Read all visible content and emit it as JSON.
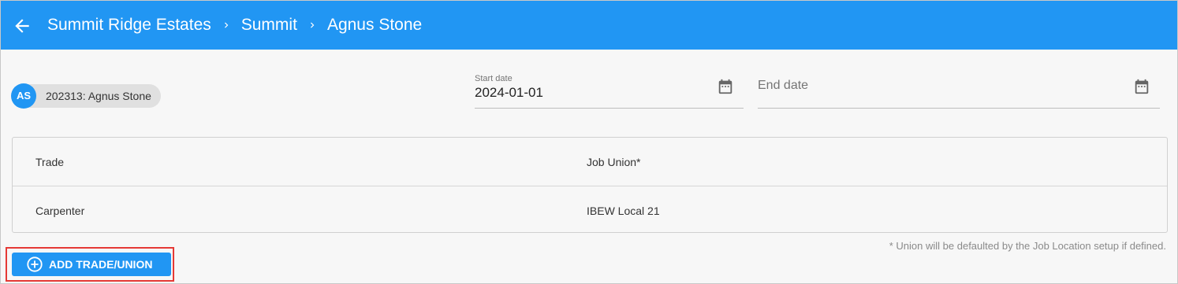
{
  "header": {
    "breadcrumbs": [
      "Summit Ridge Estates",
      "Summit",
      "Agnus Stone"
    ],
    "colors": {
      "bar": "#2196f3",
      "text": "#ffffff"
    }
  },
  "employee_chip": {
    "initials": "AS",
    "label": "202313: Agnus Stone"
  },
  "start_date": {
    "label": "Start date",
    "value": "2024-01-01"
  },
  "end_date": {
    "placeholder": "End date",
    "value": ""
  },
  "table": {
    "columns": [
      "Trade",
      "Job Union*"
    ],
    "rows": [
      [
        "Carpenter",
        "IBEW Local 21"
      ]
    ]
  },
  "note": "* Union will be defaulted by the Job Location setup if defined.",
  "add_button": {
    "label": "ADD TRADE/UNION",
    "icon": "plus-circle-icon"
  },
  "icons": {
    "back": "arrow-left-icon",
    "separator": "chevron-right-icon",
    "calendar": "calendar-icon"
  }
}
